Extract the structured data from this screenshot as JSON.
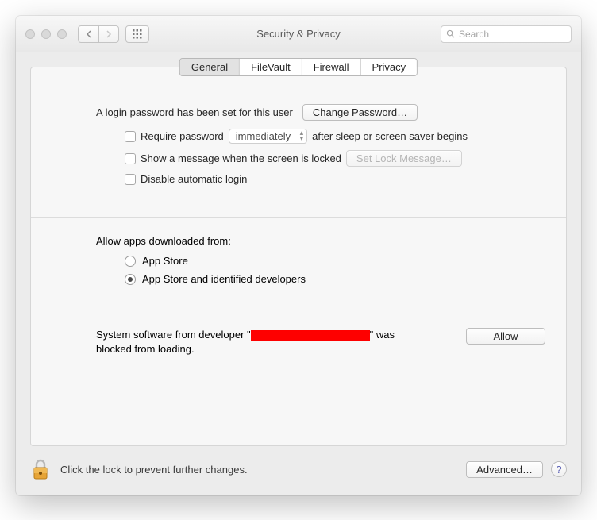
{
  "window": {
    "title": "Security & Privacy",
    "search_placeholder": "Search"
  },
  "tabs": [
    "General",
    "FileVault",
    "Firewall",
    "Privacy"
  ],
  "active_tab": 0,
  "login": {
    "message": "A login password has been set for this user",
    "change_button": "Change Password…"
  },
  "options": {
    "require_prefix": "Require password",
    "require_delay": "immediately",
    "require_suffix": "after sleep or screen saver begins",
    "show_message": "Show a message when the screen is locked",
    "set_lock_button": "Set Lock Message…",
    "disable_auto_login": "Disable automatic login"
  },
  "allow_section": {
    "label": "Allow apps downloaded from:",
    "radios": [
      "App Store",
      "App Store and identified developers"
    ],
    "selected": 1
  },
  "blocked": {
    "prefix": "System software from developer \"",
    "suffix": "\" was blocked from loading.",
    "allow_button": "Allow"
  },
  "footer": {
    "lock_text": "Click the lock to prevent further changes.",
    "advanced_button": "Advanced…",
    "help": "?"
  }
}
